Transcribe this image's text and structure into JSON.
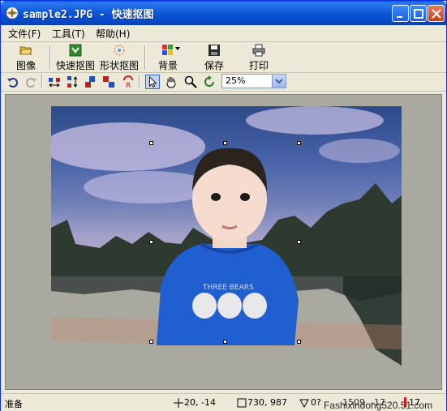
{
  "window": {
    "title": "sample2.JPG - 快速抠图"
  },
  "menu": {
    "items": [
      "文件(F)",
      "工具(T)",
      "帮助(H)"
    ]
  },
  "toolbar": {
    "image_label": "图像",
    "quick_cut_label": "快速抠图",
    "shape_cut_label": "形状抠图",
    "background_label": "背景",
    "save_label": "保存",
    "print_label": "打印"
  },
  "zoom": {
    "value": "25%"
  },
  "statusbar": {
    "status": "准备",
    "cursor_pos": "20, -14",
    "image_size": "730, 987",
    "angle": "0?",
    "extra1": "1509, -17",
    "extra2": "17"
  },
  "watermark": "Fashixindong520.51.com",
  "colors": {
    "accent": "#0a5fe6",
    "shirt": "#1f5fd0",
    "toolbar_bg": "#ece9d8"
  }
}
